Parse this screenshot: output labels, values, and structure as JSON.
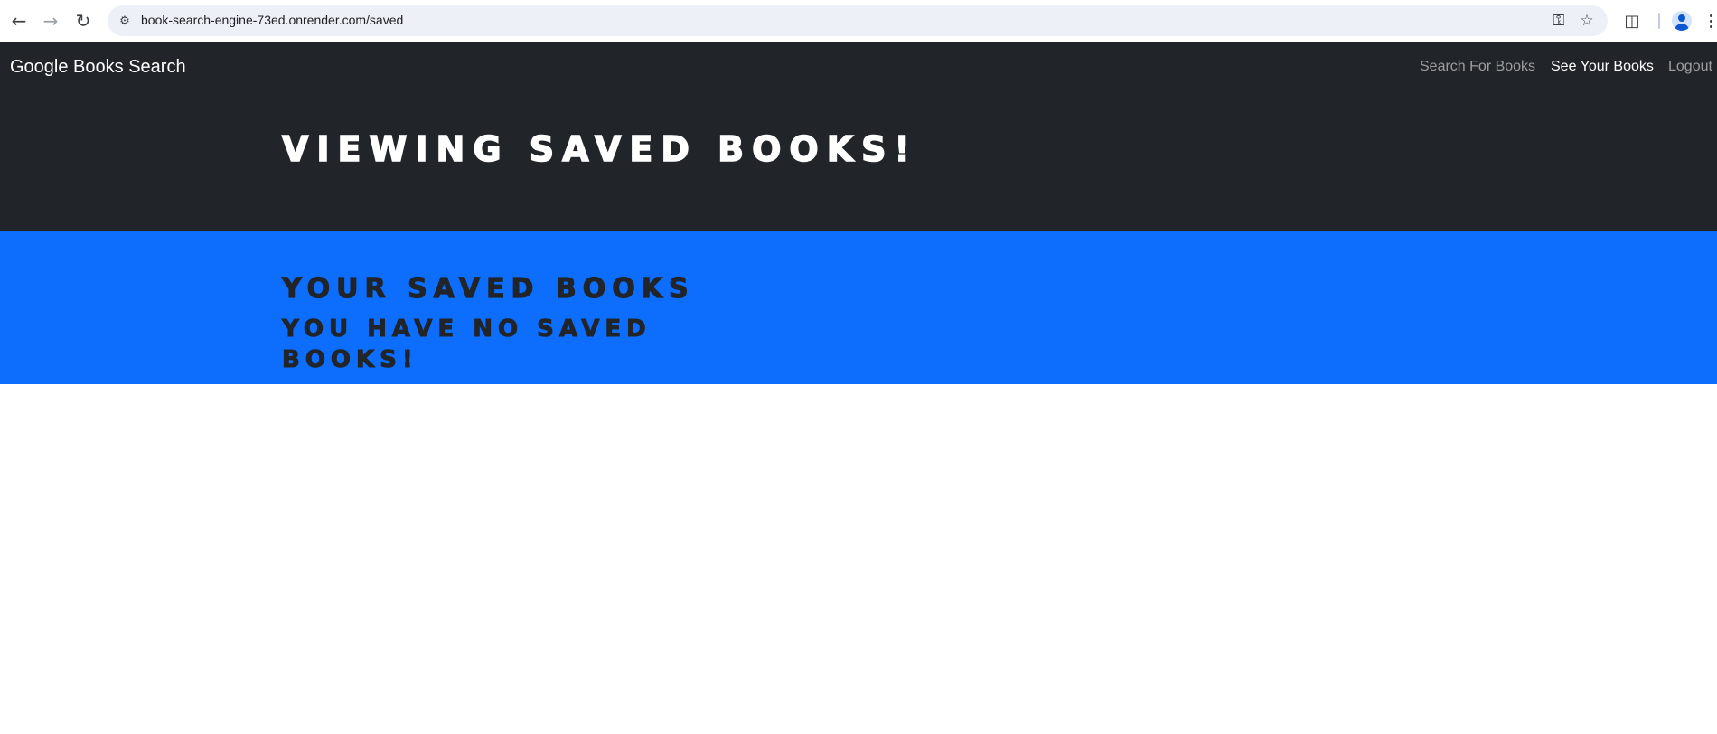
{
  "browser": {
    "url": "book-search-engine-73ed.onrender.com/saved",
    "icons": [
      "back-arrow-icon",
      "forward-arrow-icon",
      "reload-icon",
      "site-info-icon",
      "password-key-icon",
      "bookmark-star-icon",
      "extensions-icon",
      "profile-avatar-icon",
      "more-menu-icon"
    ]
  },
  "navbar": {
    "brand": "Google Books Search",
    "links": [
      {
        "label": "Search For Books",
        "active": false
      },
      {
        "label": "See Your Books",
        "active": true
      },
      {
        "label": "Logout",
        "active": false
      }
    ],
    "background": "#212529"
  },
  "hero": {
    "title": "Viewing saved books!"
  },
  "saved_section": {
    "title": "Your saved books",
    "message": "You have no saved books!",
    "background": "#0d6efd"
  }
}
